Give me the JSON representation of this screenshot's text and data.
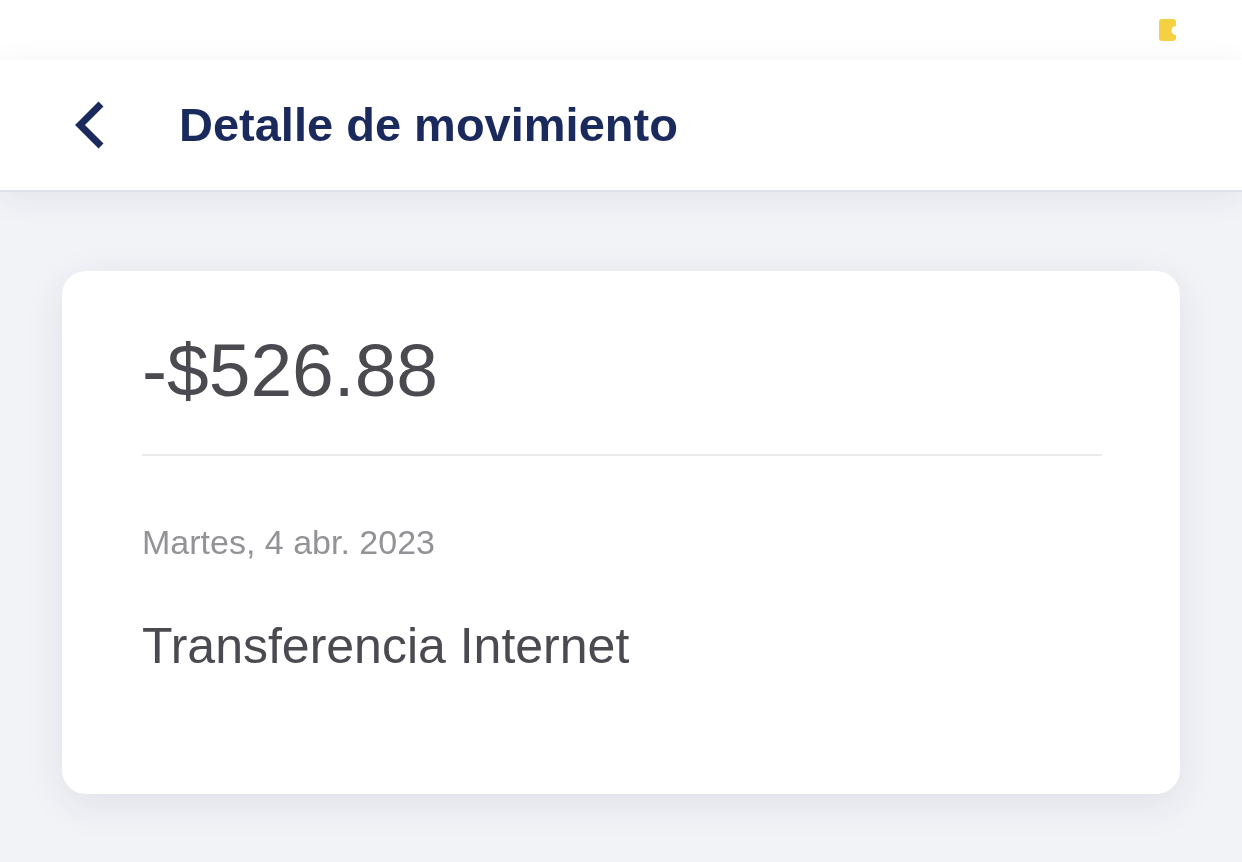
{
  "header": {
    "title": "Detalle de movimiento"
  },
  "movement": {
    "amount": "-$526.88",
    "date": "Martes, 4 abr. 2023",
    "description": "Transferencia Internet"
  }
}
